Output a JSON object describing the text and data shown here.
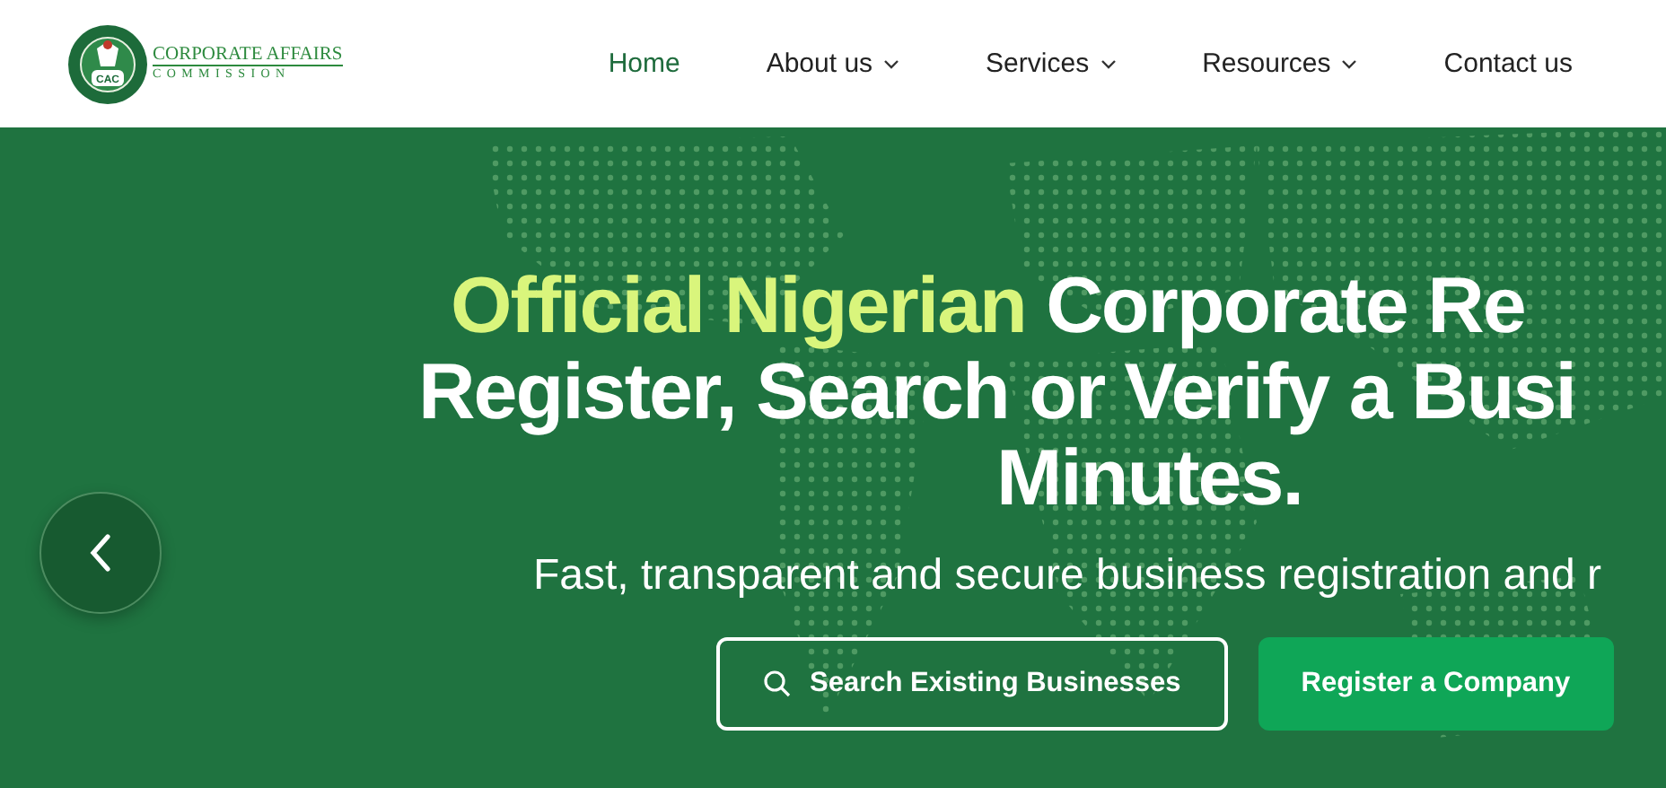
{
  "logo": {
    "emblem_text": "CAC",
    "title": "CORPORATE AFFAIRS",
    "subtitle": "COMMISSION"
  },
  "nav": [
    {
      "label": "Home",
      "selected": true,
      "dropdown": false
    },
    {
      "label": "About us",
      "selected": false,
      "dropdown": true
    },
    {
      "label": "Services",
      "selected": false,
      "dropdown": true
    },
    {
      "label": "Resources",
      "selected": false,
      "dropdown": true
    },
    {
      "label": "Contact us",
      "selected": false,
      "dropdown": false
    }
  ],
  "hero": {
    "headline_highlight": "Official Nigerian",
    "headline_rest": "Corporate Re",
    "line_2": "Register, Search or Verify a Busi",
    "line_3": "Minutes.",
    "subtitle": "Fast, transparent and secure business registration and r",
    "buttons": [
      {
        "label": "Search Existing Businesses",
        "kind": "outline"
      },
      {
        "label": "Register a Company",
        "kind": "filled"
      }
    ]
  }
}
